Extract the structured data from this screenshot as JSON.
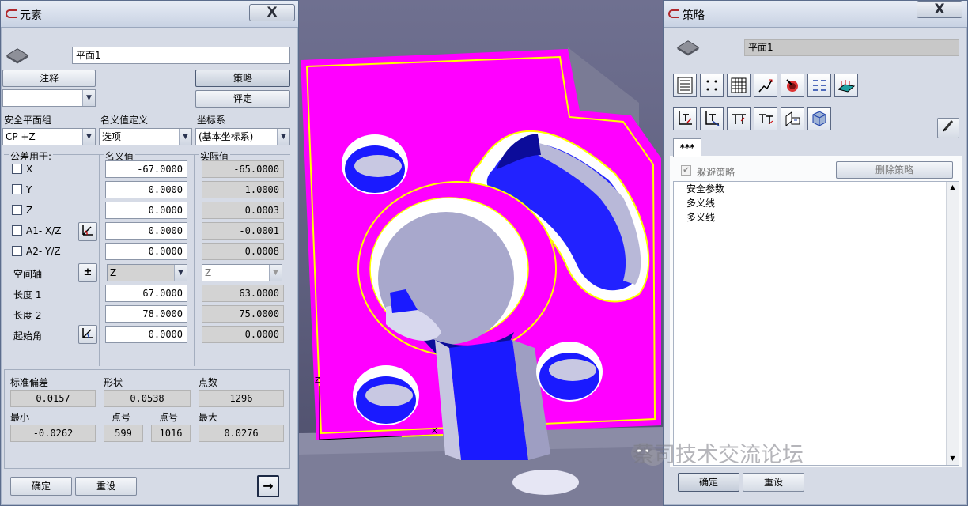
{
  "colors": {
    "magenta": "#ff00ff",
    "hole": "#1a1aff",
    "accent_yellow": "#ffff00"
  },
  "left_window": {
    "title": "元素",
    "close": "X",
    "feature_name": "平面1",
    "btn_annotate": "注释",
    "btn_strategy": "策略",
    "btn_evaluate": "评定",
    "label_safety_group": "安全平面组",
    "label_nominal_def": "名义值定义",
    "label_coord_sys": "坐标系",
    "safety_group_value": "CP +Z",
    "nominal_def_value": "选项",
    "coord_sys_value": "(基本坐标系)",
    "header_tol": "公差用于:",
    "header_nominal": "名义值",
    "header_actual": "实际值",
    "rows": [
      {
        "label": "X",
        "nominal": "-67.0000",
        "actual": "-65.0000"
      },
      {
        "label": "Y",
        "nominal": "0.0000",
        "actual": "1.0000"
      },
      {
        "label": "Z",
        "nominal": "0.0000",
        "actual": "0.0003"
      },
      {
        "label": "A1- X/Z",
        "nominal": "0.0000",
        "actual": "-0.0001"
      },
      {
        "label": "A2- Y/Z",
        "nominal": "0.0000",
        "actual": "0.0008"
      }
    ],
    "label_space_axis": "空间轴",
    "space_axis_nominal": "Z",
    "space_axis_actual": "Z",
    "pm_symbol": "±",
    "label_length1": "长度 1",
    "length1_nominal": "67.0000",
    "length1_actual": "63.0000",
    "label_length2": "长度 2",
    "length2_nominal": "78.0000",
    "length2_actual": "75.0000",
    "label_start_angle": "起始角",
    "start_angle_nominal": "0.0000",
    "start_angle_actual": "0.0000",
    "stats": {
      "label_stddev": "标准偏差",
      "stddev": "0.0157",
      "label_form": "形状",
      "form": "0.0538",
      "label_points": "点数",
      "points": "1296",
      "label_min": "最小",
      "min": "-0.0262",
      "label_pt_no1": "点号",
      "pt_no1": "599",
      "label_pt_no2": "点号",
      "pt_no2": "1016",
      "label_max": "最大",
      "max": "0.0276"
    },
    "btn_ok": "确定",
    "btn_reset": "重设",
    "btn_arrow": "→"
  },
  "viewport": {
    "axis_z": "Z",
    "axis_x": "X"
  },
  "right_window": {
    "title": "策略",
    "close": "X",
    "feature_name": "平面1",
    "tab_label": "***",
    "checkbox_avoid": "躲避策略",
    "btn_delete_strategy": "删除策略",
    "list_items": [
      "安全参数",
      "多义线",
      "多义线"
    ],
    "btn_ok": "确定",
    "btn_reset": "重设"
  },
  "watermark": "蔡司技术交流论坛"
}
